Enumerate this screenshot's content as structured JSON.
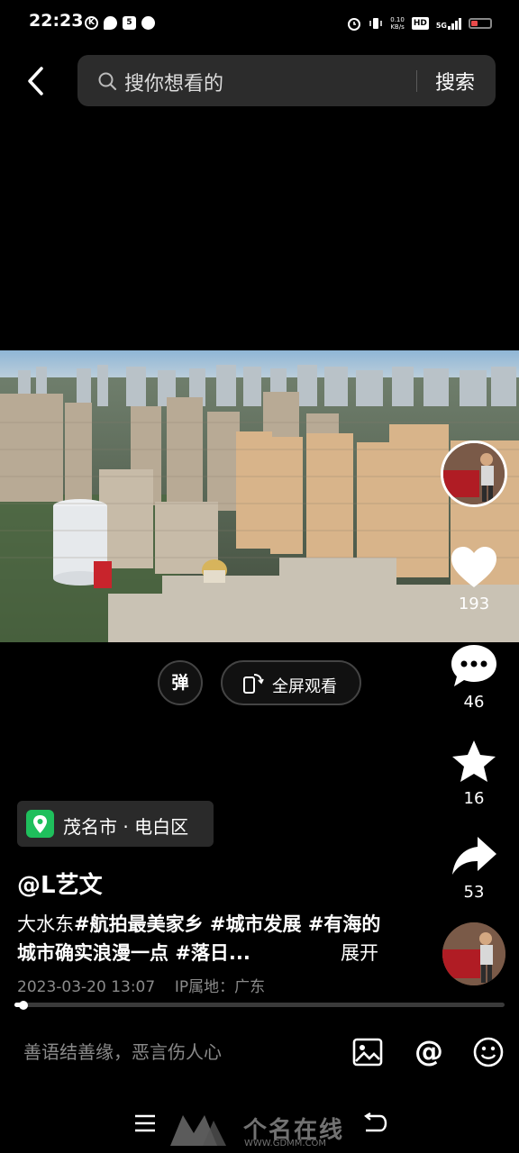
{
  "status_bar": {
    "time": "22:23",
    "net_speed_value": "0.10",
    "net_speed_unit": "KB/s",
    "hd_label": "HD",
    "network_label": "5G"
  },
  "header": {
    "search_placeholder": "搜你想看的",
    "search_button": "搜索"
  },
  "video": {
    "danmaku_label": "弹",
    "fullscreen_label": "全屏观看"
  },
  "side_actions": {
    "likes": "193",
    "comments": "46",
    "favorites": "16",
    "shares": "53"
  },
  "post": {
    "location": "茂名市 · 电白区",
    "author": "@L艺文",
    "caption_text": "大水东",
    "caption_tags": [
      "#航拍最美家乡 ",
      "#城市发展 ",
      "#有海的城市确实浪漫一点 ",
      "#落日..."
    ],
    "expand_label": "展开",
    "date": "2023-03-20 13:07",
    "ip_location": "IP属地：广东"
  },
  "progress": {
    "fraction": 0.018
  },
  "comment_bar": {
    "placeholder": "善语结善缘，恶言伤人心"
  },
  "watermark": {
    "brand": "个名在线",
    "url": "WWW.GDMM.COM"
  },
  "colors": {
    "location_pin": "#1fbf5c",
    "battery_low": "#e84a4a",
    "search_box": "#2c2c2c"
  }
}
